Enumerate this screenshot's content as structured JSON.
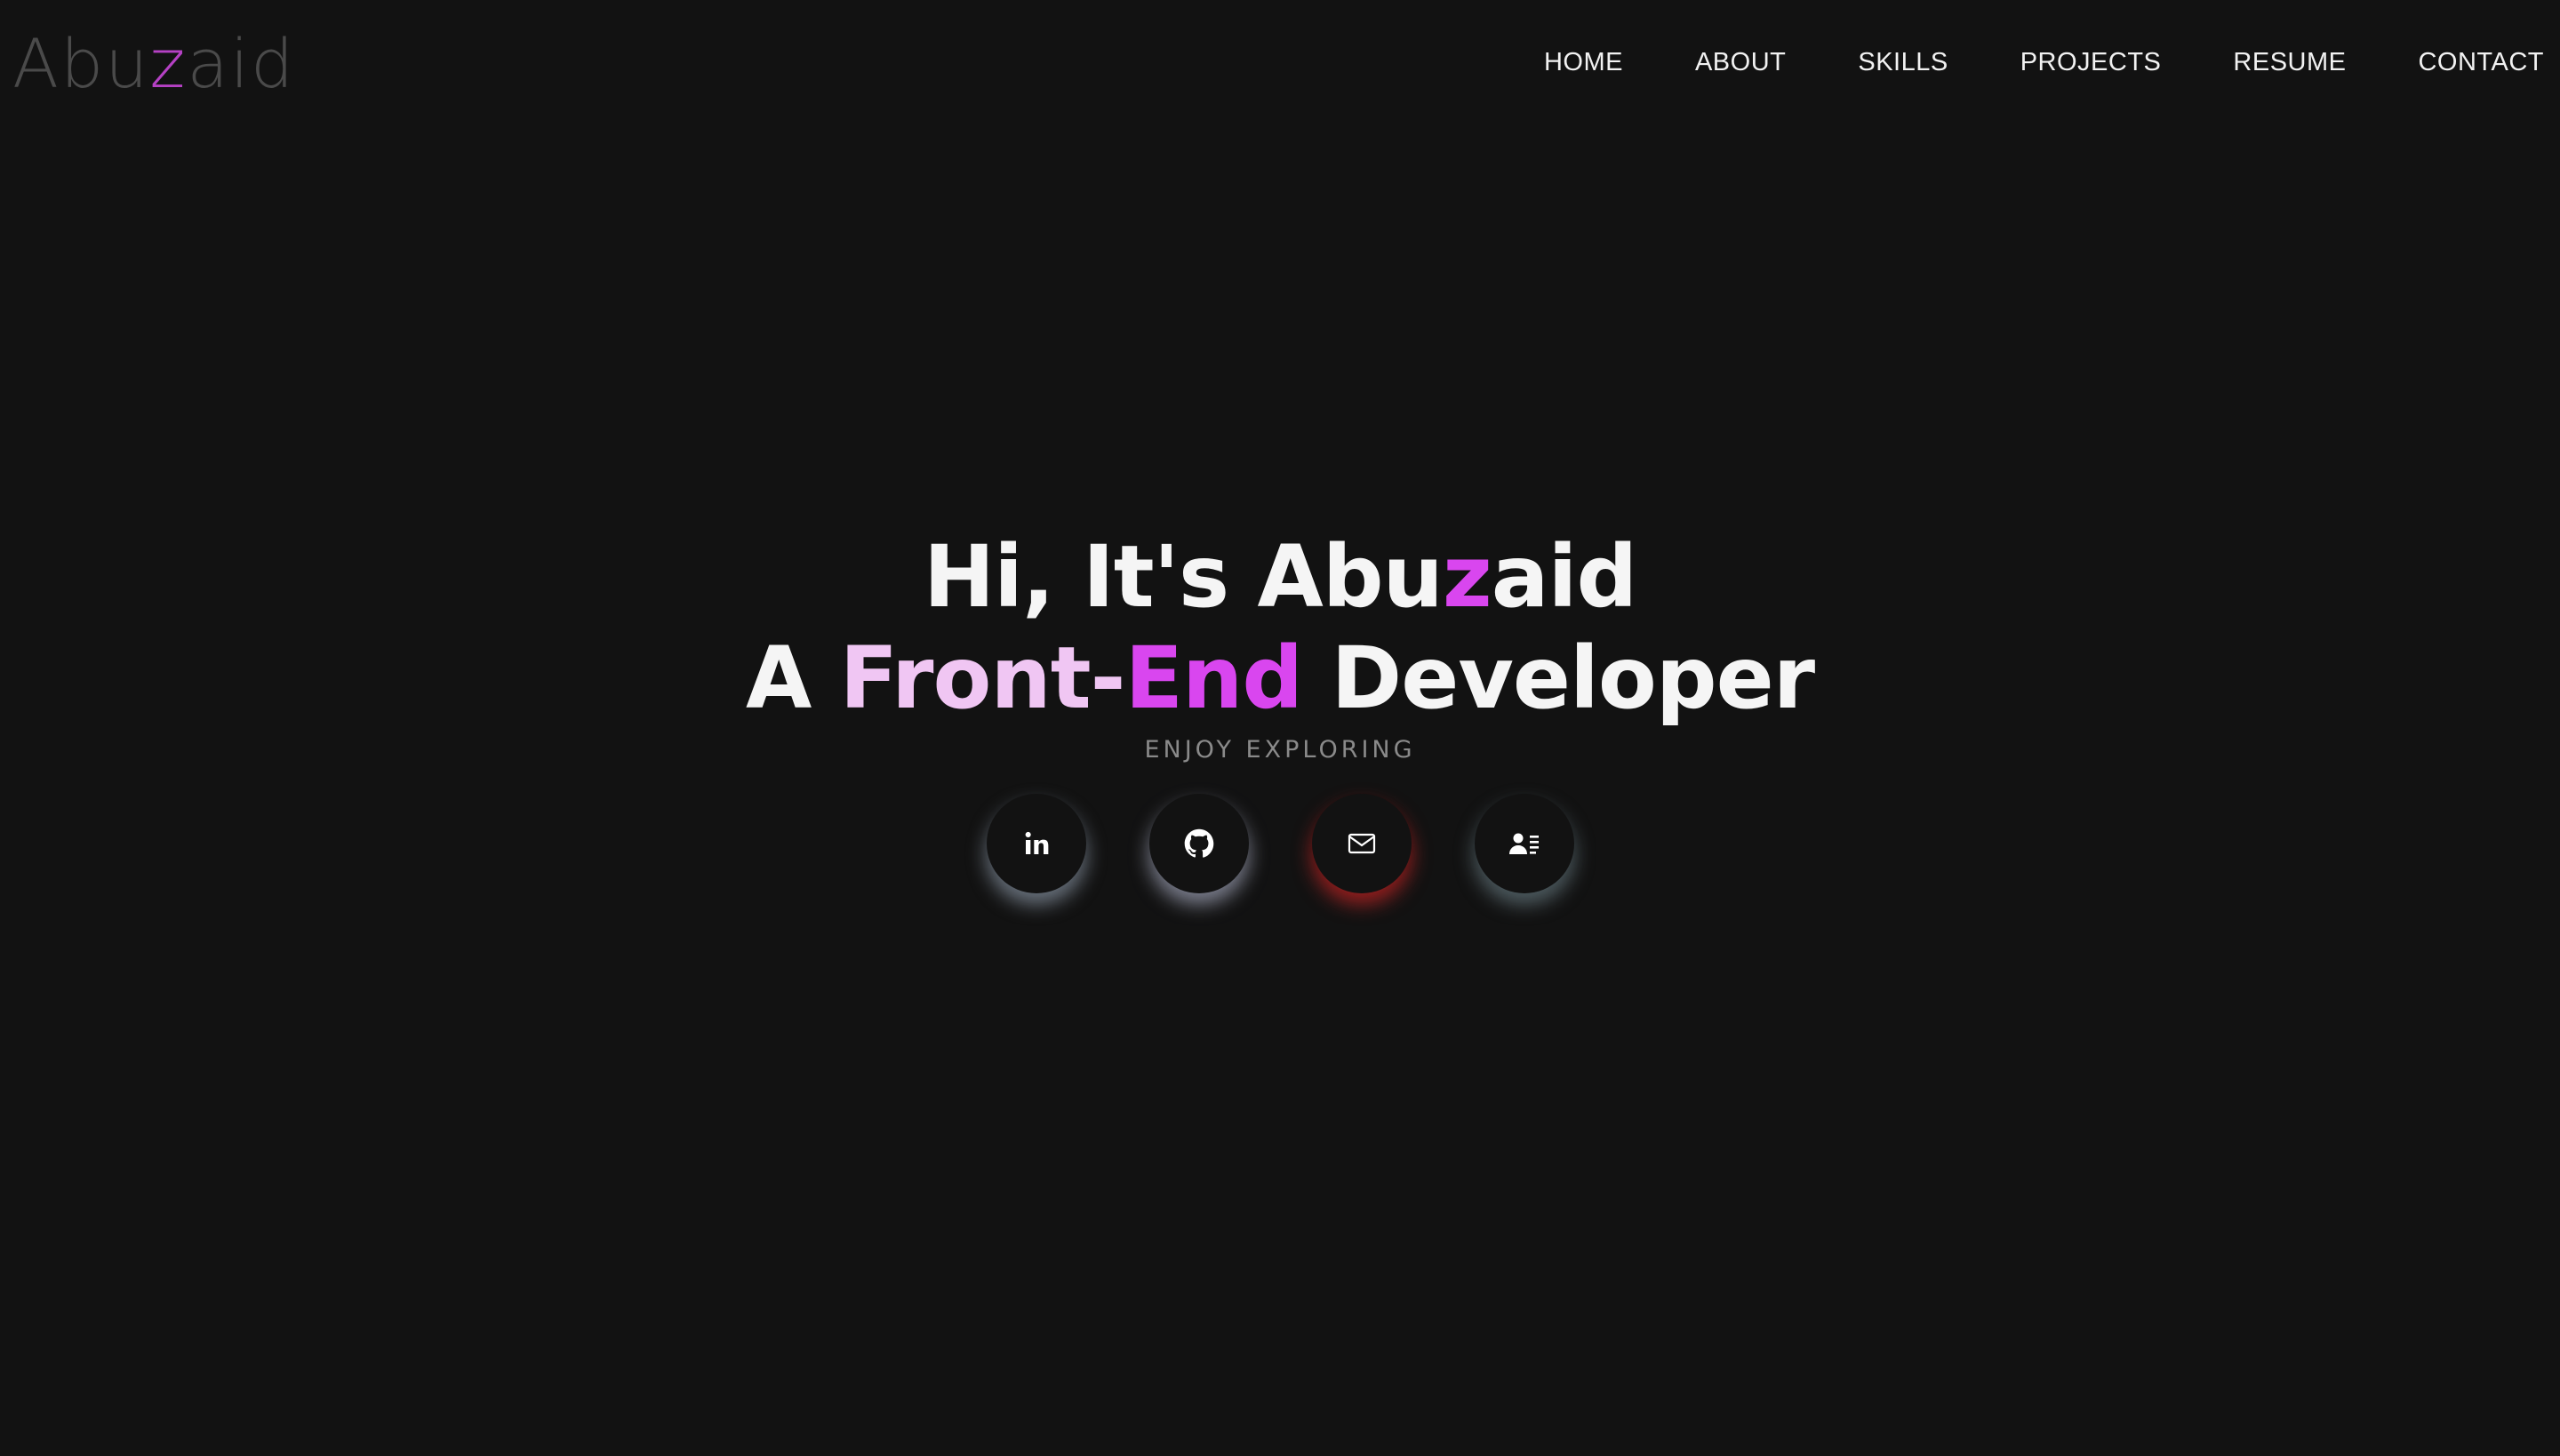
{
  "header": {
    "logo": {
      "prefix": "Abu",
      "accent": "z",
      "suffix": "aid"
    },
    "nav": [
      "HOME",
      "ABOUT",
      "SKILLS",
      "PROJECTS",
      "RESUME",
      "CONTACT"
    ]
  },
  "hero": {
    "line1": {
      "prefix": "Hi, It's Abu",
      "accent": "z",
      "suffix": "aid"
    },
    "line2": {
      "prefix": "A ",
      "light": "Front-",
      "accent": "End",
      "suffix": " Developer"
    },
    "subtitle": "ENJOY EXPLORING"
  },
  "socials": [
    {
      "name": "linkedin",
      "icon": "linkedin-icon"
    },
    {
      "name": "github",
      "icon": "github-icon"
    },
    {
      "name": "mail",
      "icon": "mail-icon"
    },
    {
      "name": "resume",
      "icon": "resume-icon"
    }
  ],
  "colors": {
    "background": "#121212",
    "accent": "#d946ef",
    "accent_light": "#f0c6f3",
    "logo_gray": "#4a4a4a",
    "subtitle_gray": "#8a8a8a"
  }
}
